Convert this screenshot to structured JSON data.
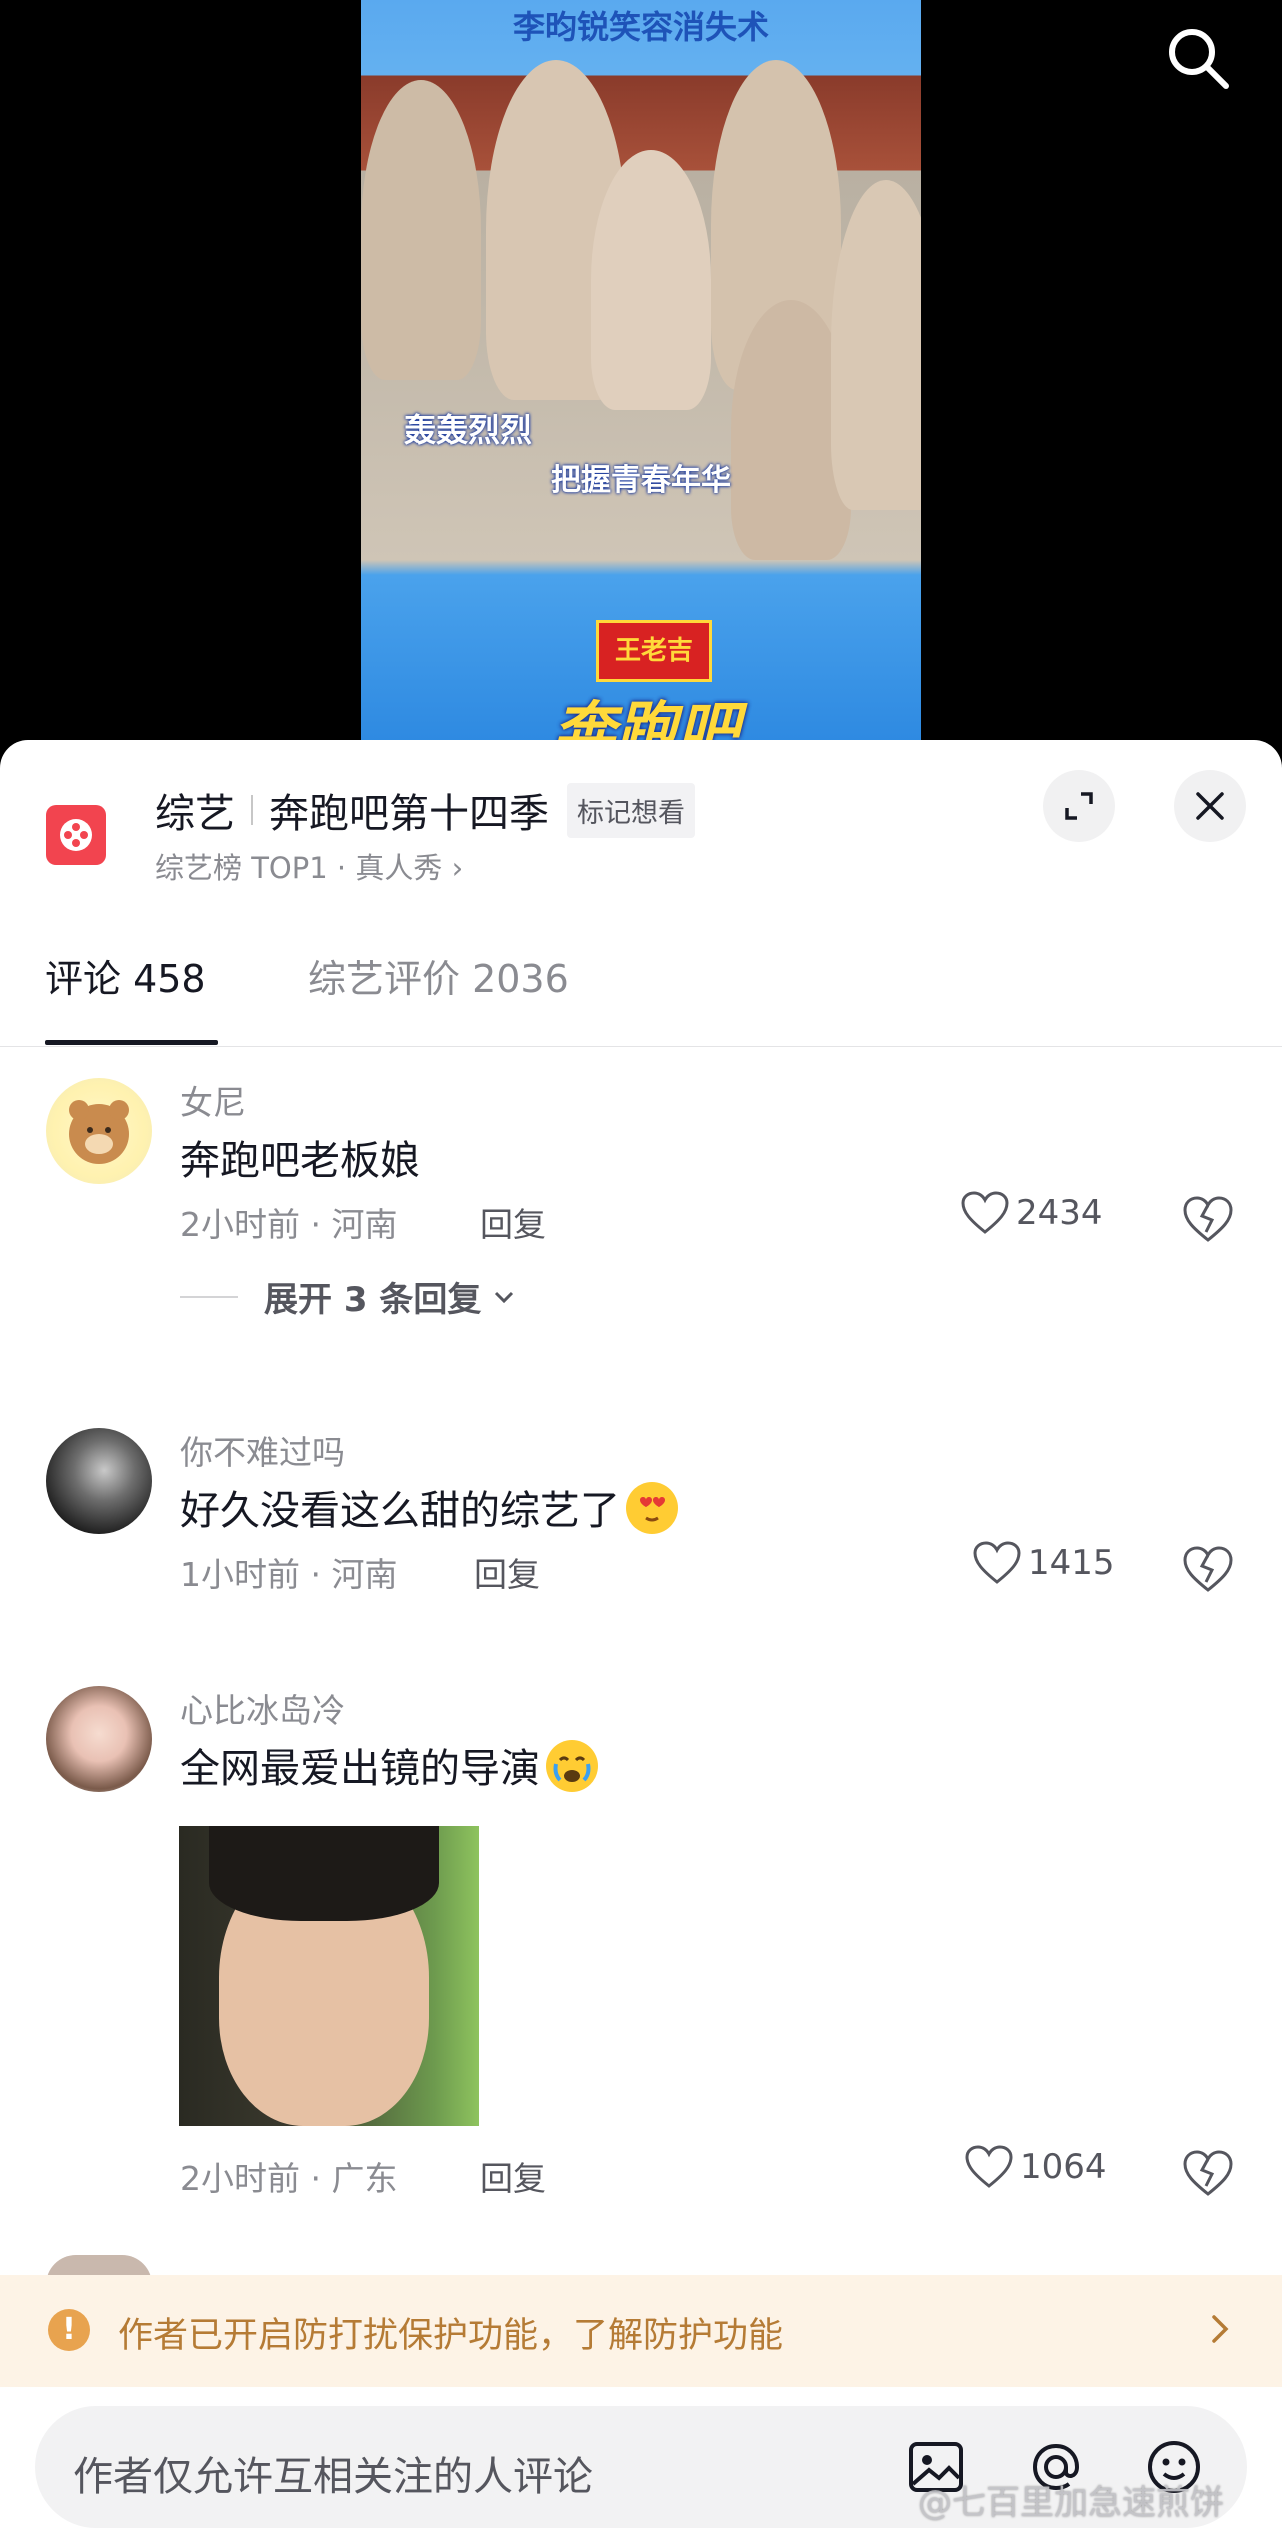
{
  "video": {
    "caption_top": "李昀锐笑容消失术",
    "caption_name": "轰轰烈烈",
    "caption_sub": "把握青春年华",
    "logo_top": "王老吉",
    "logo_main": "奔跑吧"
  },
  "sheet": {
    "category": "综艺",
    "show_title": "奔跑吧第十四季",
    "mark_label": "标记想看",
    "subline": "综艺榜 TOP1 · 真人秀 ›"
  },
  "tabs": {
    "comments": "评论 458",
    "reviews": "综艺评价 2036"
  },
  "comments": [
    {
      "user": "女尼",
      "text": "奔跑吧老板娘",
      "meta": "2小时前 · 河南",
      "reply": "回复",
      "likes": "2434",
      "expand": "展开 3 条回复"
    },
    {
      "user": "你不难过吗",
      "text": "好久没看这么甜的综艺了",
      "meta": "1小时前 · 河南",
      "reply": "回复",
      "likes": "1415"
    },
    {
      "user": "心比冰岛冷",
      "text": "全网最爱出镜的导演",
      "meta": "2小时前 · 广东",
      "reply": "回复",
      "likes": "1064"
    }
  ],
  "notice": "作者已开启防打扰保护功能，了解防护功能",
  "input_placeholder": "作者仅允许互相关注的人评论",
  "watermark": "@七百里加急速煎饼",
  "icons": [
    "search-icon",
    "expand-icon",
    "close-icon",
    "heart-icon",
    "dislike-icon",
    "image-icon",
    "at-icon",
    "emoji-icon",
    "warning-icon",
    "chevron-right-icon"
  ]
}
